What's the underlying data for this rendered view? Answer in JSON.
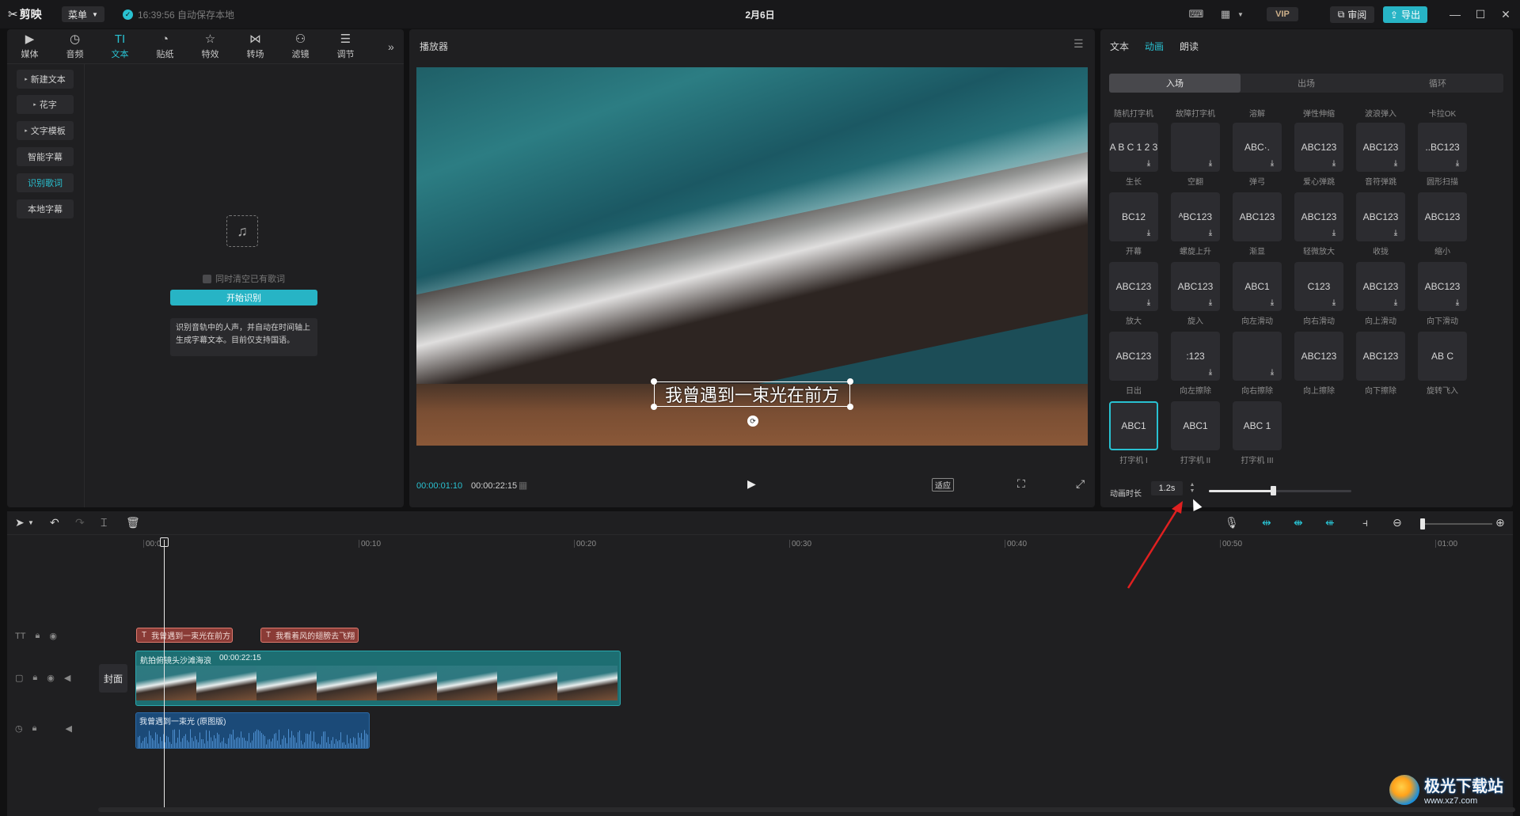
{
  "titlebar": {
    "app_name": "剪映",
    "menu_label": "菜单",
    "save_status": "16:39:56 自动保存本地",
    "doc_title": "2月6日",
    "vip_label": "VIP",
    "review_label": "审阅",
    "export_label": "导出"
  },
  "tool_tabs": [
    {
      "label": "媒体",
      "icon": "media-icon",
      "glyph": "▶"
    },
    {
      "label": "音频",
      "icon": "audio-icon",
      "glyph": "◷"
    },
    {
      "label": "文本",
      "icon": "text-icon",
      "glyph": "TI"
    },
    {
      "label": "贴纸",
      "icon": "sticker-icon",
      "glyph": "◔"
    },
    {
      "label": "特效",
      "icon": "effects-icon",
      "glyph": "☆"
    },
    {
      "label": "转场",
      "icon": "transition-icon",
      "glyph": "⋈"
    },
    {
      "label": "滤镜",
      "icon": "filter-icon",
      "glyph": "⚇"
    },
    {
      "label": "调节",
      "icon": "adjust-icon",
      "glyph": "☰"
    }
  ],
  "text_sidebar": [
    {
      "label": "新建文本",
      "arrow": "▸"
    },
    {
      "label": "花字",
      "arrow": "▸"
    },
    {
      "label": "文字模板",
      "arrow": "▸"
    },
    {
      "label": "智能字幕",
      "arrow": ""
    },
    {
      "label": "识别歌词",
      "arrow": ""
    },
    {
      "label": "本地字幕",
      "arrow": ""
    }
  ],
  "lyrics": {
    "clear_checkbox_label": "同时清空已有歌词",
    "start_button": "开始识别",
    "help_text": "识别音轨中的人声，并自动在时间轴上生成字幕文本。目前仅支持国语。"
  },
  "player": {
    "title": "播放器",
    "caption": "我曾遇到一束光在前方",
    "current_time": "00:00:01:10",
    "total_time": "00:00:22:15",
    "fit_label": "适应"
  },
  "right_panel": {
    "tabs": [
      "文本",
      "动画",
      "朗读"
    ],
    "active_tab": "动画",
    "anim_tabs": [
      "入场",
      "出场",
      "循环"
    ],
    "active_anim_tab": "入场",
    "top_row_names": [
      "随机打字机",
      "故障打字机",
      "溶解",
      "弹性伸缩",
      "波浪弹入",
      "卡拉OK"
    ],
    "animations": [
      {
        "name": "生长",
        "preview": "A B C 1 2 3",
        "dl": true
      },
      {
        "name": "空翻",
        "preview": "",
        "dl": true
      },
      {
        "name": "弹弓",
        "preview": "ABC·.",
        "dl": true
      },
      {
        "name": "爱心弹跳",
        "preview": "ABC123",
        "dl": true
      },
      {
        "name": "音符弹跳",
        "preview": "ABC123",
        "dl": true
      },
      {
        "name": "圆形扫描",
        "preview": "..BC123",
        "dl": true
      },
      {
        "name": "开幕",
        "preview": "BC12",
        "dl": true
      },
      {
        "name": "螺旋上升",
        "preview": "ᴬBC123",
        "dl": true
      },
      {
        "name": "渐显",
        "preview": "ABC123",
        "dl": false
      },
      {
        "name": "轻微放大",
        "preview": "ABC123",
        "dl": true
      },
      {
        "name": "收拢",
        "preview": "ABC123",
        "dl": true
      },
      {
        "name": "缩小",
        "preview": "ABC123",
        "dl": false
      },
      {
        "name": "放大",
        "preview": "ABC123",
        "dl": true
      },
      {
        "name": "旋入",
        "preview": "ABC123",
        "dl": true
      },
      {
        "name": "向左滑动",
        "preview": "ABC1",
        "dl": true
      },
      {
        "name": "向右滑动",
        "preview": "C123",
        "dl": true
      },
      {
        "name": "向上滑动",
        "preview": "ABC123",
        "dl": true
      },
      {
        "name": "向下滑动",
        "preview": "ABC123",
        "dl": true
      },
      {
        "name": "日出",
        "preview": "ABC123",
        "dl": false
      },
      {
        "name": "向左擦除",
        "preview": ":123",
        "dl": true
      },
      {
        "name": "向右擦除",
        "preview": "",
        "dl": true
      },
      {
        "name": "向上擦除",
        "preview": "ABC123",
        "dl": false
      },
      {
        "name": "向下擦除",
        "preview": "ABC123",
        "dl": false
      },
      {
        "name": "旋转飞入",
        "preview": "AB C",
        "dl": false
      },
      {
        "name": "打字机 I",
        "preview": "ABC1",
        "dl": false,
        "selected": true
      },
      {
        "name": "打字机 II",
        "preview": "ABC1",
        "dl": false
      },
      {
        "name": "打字机 III",
        "preview": "ABC 1",
        "dl": false
      }
    ],
    "duration_label": "动画时长",
    "duration_value": "1.2s",
    "duration_fraction": 0.45
  },
  "timeline": {
    "ruler_labels": [
      "00:00",
      "00:10",
      "00:20",
      "00:30",
      "00:40",
      "00:50",
      "01:00"
    ],
    "text_clips": [
      "我曾遇到一束光在前方",
      "我看着风的翅膀去飞翔"
    ],
    "video_clip_name": "航拍俯镜头沙滩海浪",
    "video_clip_duration": "00:00:22:15",
    "audio_clip_name": "我曾遇到一束光 (原图版)",
    "cover_label": "封面"
  },
  "watermark": {
    "text": "极光下载站",
    "url": "www.xz7.com"
  },
  "colors": {
    "accent": "#29c1d1",
    "text_clip": "#8a3b36",
    "video_clip": "#1d6e72",
    "audio_clip": "#1b4a78",
    "arrow": "#e02020"
  }
}
